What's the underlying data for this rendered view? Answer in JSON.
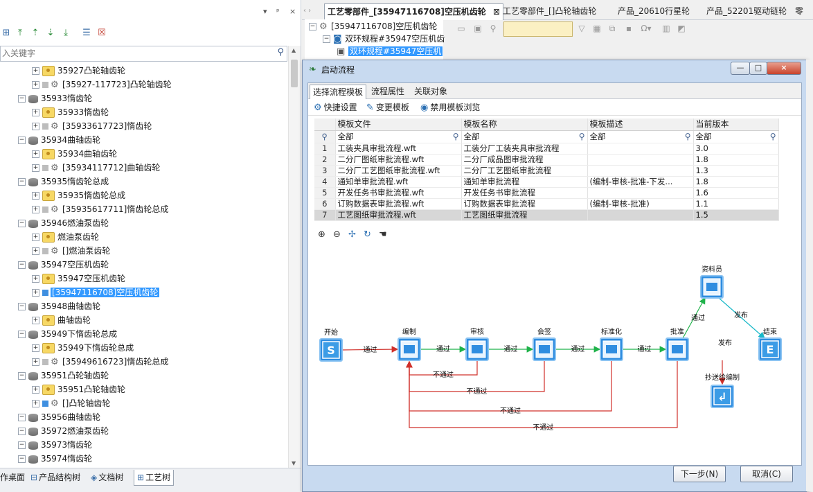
{
  "left_panel": {
    "title_controls": [
      "▾",
      "ᵖ",
      "×"
    ],
    "search_placeholder": "入关键字",
    "tree": [
      {
        "indent": 2,
        "icon": "folder",
        "label": "35927凸轮轴齿轮"
      },
      {
        "indent": 3,
        "icon": "gear",
        "label": "[35927-117723]凸轮轴齿轮"
      },
      {
        "indent": 1,
        "icon": "db",
        "label": "35933惰齿轮"
      },
      {
        "indent": 2,
        "icon": "folder",
        "label": "35933惰齿轮"
      },
      {
        "indent": 3,
        "icon": "gear",
        "label": "[35933617723]惰齿轮"
      },
      {
        "indent": 1,
        "icon": "db",
        "label": "35934曲轴齿轮"
      },
      {
        "indent": 2,
        "icon": "folder",
        "label": "35934曲轴齿轮"
      },
      {
        "indent": 3,
        "icon": "gear",
        "label": "[35934117712]曲轴齿轮"
      },
      {
        "indent": 1,
        "icon": "db",
        "label": "35935惰齿轮总成"
      },
      {
        "indent": 2,
        "icon": "folder",
        "label": "35935惰齿轮总成"
      },
      {
        "indent": 3,
        "icon": "gear",
        "label": "[35935617711]惰齿轮总成"
      },
      {
        "indent": 1,
        "icon": "db",
        "label": "35946燃油泵齿轮"
      },
      {
        "indent": 2,
        "icon": "folder",
        "label": "燃油泵齿轮"
      },
      {
        "indent": 3,
        "icon": "gear",
        "label": "[]燃油泵齿轮"
      },
      {
        "indent": 1,
        "icon": "db",
        "label": "35947空压机齿轮"
      },
      {
        "indent": 2,
        "icon": "folder",
        "label": "35947空压机齿轮"
      },
      {
        "indent": 3,
        "icon": "blue",
        "label": "[35947116708]空压机齿轮",
        "selected": true
      },
      {
        "indent": 1,
        "icon": "db",
        "label": "35948曲轴齿轮"
      },
      {
        "indent": 2,
        "icon": "folder",
        "label": "曲轴齿轮"
      },
      {
        "indent": 1,
        "icon": "db",
        "label": "35949下惰齿轮总成"
      },
      {
        "indent": 2,
        "icon": "folder",
        "label": "35949下惰齿轮总成"
      },
      {
        "indent": 3,
        "icon": "gear",
        "label": "[35949616723]惰齿轮总成"
      },
      {
        "indent": 1,
        "icon": "db",
        "label": "35951凸轮轴齿轮"
      },
      {
        "indent": 2,
        "icon": "folder",
        "label": "35951凸轮轴齿轮"
      },
      {
        "indent": 3,
        "icon": "bluegear",
        "label": "[]凸轮轴齿轮"
      },
      {
        "indent": 1,
        "icon": "db",
        "label": "35956曲轴齿轮"
      },
      {
        "indent": 1,
        "icon": "db",
        "label": "35972燃油泵齿轮"
      },
      {
        "indent": 1,
        "icon": "db",
        "label": "35973惰齿轮"
      },
      {
        "indent": 1,
        "icon": "db",
        "label": "35974惰齿轮"
      }
    ],
    "bottom_tabs": [
      "作桌面",
      "产品结构树",
      "文档树",
      "工艺树"
    ]
  },
  "doc_tabs": [
    {
      "label": "工艺零部件_[35947116708]空压机齿轮",
      "active": true
    },
    {
      "label": "工艺零部件_[]凸轮轴齿轮"
    },
    {
      "label": "产品_20610行星轮"
    },
    {
      "label": "产品_52201驱动链轮"
    },
    {
      "label": "零"
    }
  ],
  "right_tree": {
    "root": "[35947116708]空压机齿轮",
    "child": "双环规程#35947空压机齿",
    "leaf": "双环规程#35947空压机"
  },
  "dialog": {
    "title": "启动流程",
    "window_controls": [
      "—",
      "□",
      "×"
    ],
    "tabs": [
      "选择流程模板",
      "流程属性",
      "关联对象"
    ],
    "actions": [
      "快捷设置",
      "变更模板",
      "禁用模板浏览"
    ],
    "columns": [
      "模板文件",
      "模板名称",
      "模板描述",
      "当前版本"
    ],
    "filter_value": "全部",
    "rows": [
      {
        "no": "1",
        "file": "工装夹具审批流程.wft",
        "name": "工装分厂工装夹具审批流程",
        "desc": "",
        "ver": "3.0"
      },
      {
        "no": "2",
        "file": "二分厂图纸审批流程.wft",
        "name": "二分厂成品图审批流程",
        "desc": "",
        "ver": "1.8"
      },
      {
        "no": "3",
        "file": "二分厂工艺图纸审批流程.wft",
        "name": "二分厂工艺图纸审批流程",
        "desc": "",
        "ver": "1.3"
      },
      {
        "no": "4",
        "file": "通知单审批流程.wft",
        "name": "通知单审批流程",
        "desc": "(编制-审核-批准-下发...",
        "ver": "1.8"
      },
      {
        "no": "5",
        "file": "开发任务书审批流程.wft",
        "name": "开发任务书审批流程",
        "desc": "",
        "ver": "1.6"
      },
      {
        "no": "6",
        "file": "订购数据表审批流程.wft",
        "name": "订购数据表审批流程",
        "desc": "(编制-审核-批准)",
        "ver": "1.1"
      },
      {
        "no": "7",
        "file": "工艺图纸审批流程.wft",
        "name": "工艺图纸审批流程",
        "desc": "",
        "ver": "1.5",
        "selected": true
      }
    ],
    "workflow": {
      "nodes": {
        "start": "开始",
        "draft": "编制",
        "review": "审核",
        "countersign": "会签",
        "standardize": "标准化",
        "approve": "批准",
        "archivist": "资料员",
        "end": "结束",
        "cc": "抄送给编制"
      },
      "pass": "通过",
      "reject": "不通过",
      "publish": "发布"
    },
    "buttons": {
      "next": "下一步(N)",
      "cancel": "取消(C)"
    }
  }
}
